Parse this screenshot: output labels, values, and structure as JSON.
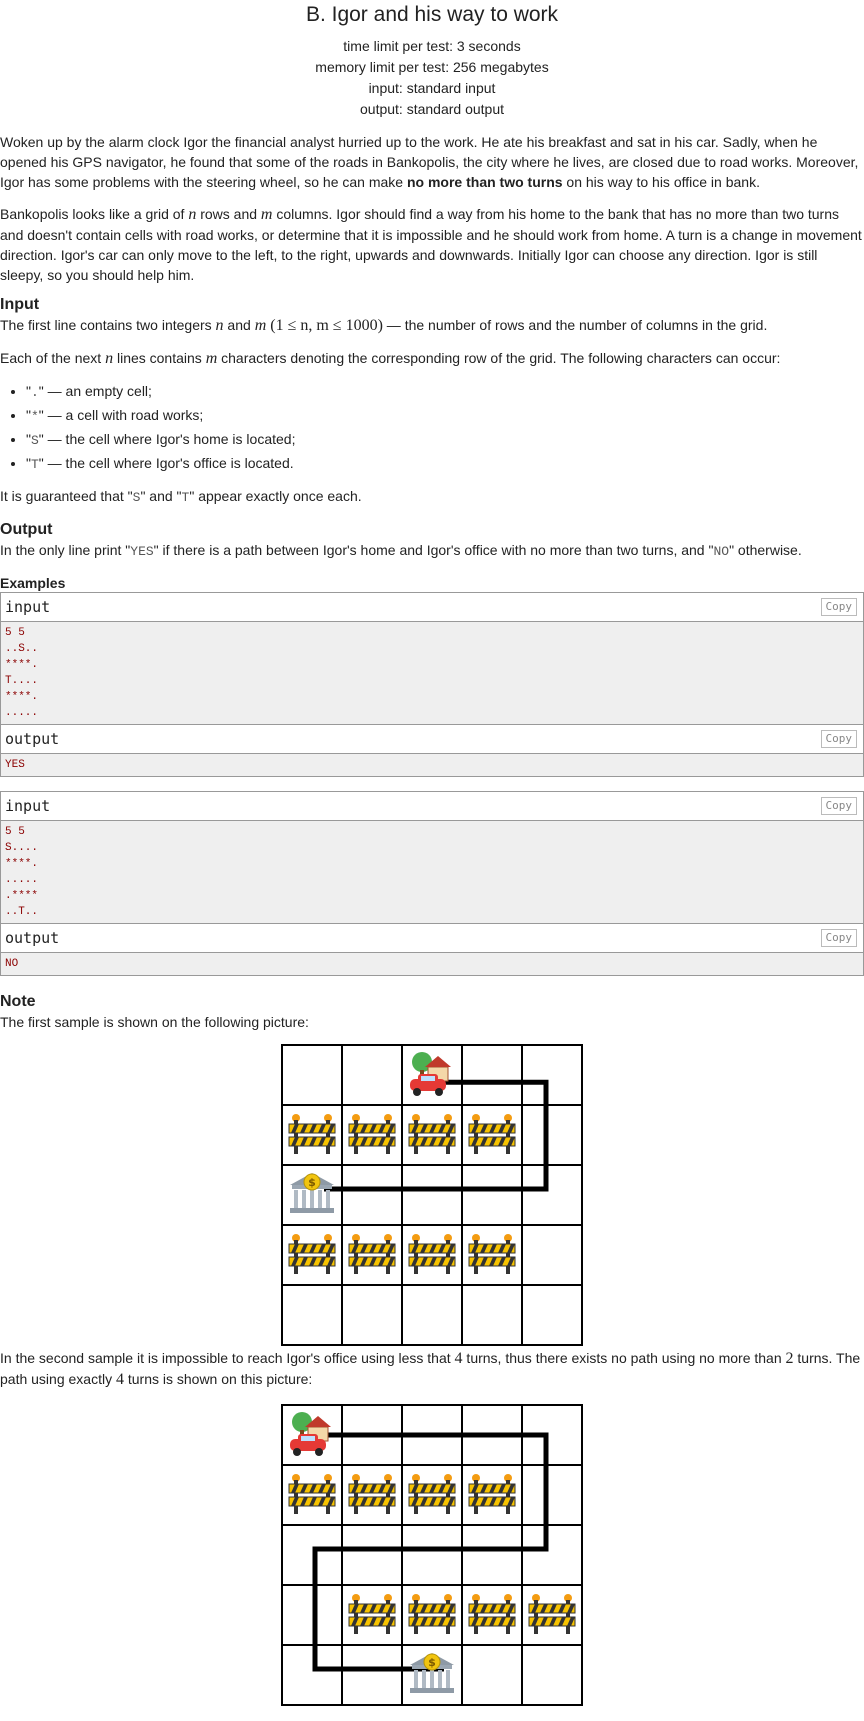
{
  "problem": {
    "title": "B. Igor and his way to work",
    "limits": [
      "time limit per test: 3 seconds",
      "memory limit per test: 256 megabytes",
      "input: standard input",
      "output: standard output"
    ]
  },
  "legend": {
    "p1_before": "Woken up by the alarm clock Igor the financial analyst hurried up to the work. He ate his breakfast and sat in his car. Sadly, when he opened his GPS navigator, he found that some of the roads in Bankopolis, the city where he lives, are closed due to road works. Moreover, Igor has some problems with the steering wheel, so he can make ",
    "p1_bold": "no more than two turns",
    "p1_after": " on his way to his office in bank.",
    "p2_a": "Bankopolis looks like a grid of ",
    "p2_n": "n",
    "p2_b": " rows and ",
    "p2_m": "m",
    "p2_c": " columns. Igor should find a way from his home to the bank that has no more than two turns and doesn't contain cells with road works, or determine that it is impossible and he should work from home. A turn is a change in movement direction. Igor's car can only move to the left, to the right, upwards and downwards. Initially Igor can choose any direction. Igor is still sleepy, so you should help him."
  },
  "input_spec": {
    "title": "Input",
    "l1_a": "The first line contains two integers ",
    "l1_n": "n",
    "l1_and": " and ",
    "l1_m": "m",
    "l1_constraint": " (1 ≤ n, m ≤ 1000)",
    "l1_b": " — the number of rows and the number of columns in the grid.",
    "l2_a": "Each of the next ",
    "l2_n": "n",
    "l2_b": " lines contains ",
    "l2_m": "m",
    "l2_c": " characters denoting the corresponding row of the grid. The following characters can occur:",
    "items": [
      {
        "q1": "\"",
        "code": ".",
        "q2": "\"",
        "desc": " — an empty cell;"
      },
      {
        "q1": "\"",
        "code": "*",
        "q2": "\"",
        "desc": " — a cell with road works;"
      },
      {
        "q1": "\"",
        "code": "S",
        "q2": "\"",
        "desc": " — the cell where Igor's home is located;"
      },
      {
        "q1": "\"",
        "code": "T",
        "q2": "\"",
        "desc": " — the cell where Igor's office is located."
      }
    ],
    "g_a": "It is guaranteed that \"",
    "g_s": "S",
    "g_b": "\" and \"",
    "g_t": "T",
    "g_c": "\" appear exactly once each."
  },
  "output_spec": {
    "title": "Output",
    "a": "In the only line print \"",
    "yes": "YES",
    "b": "\" if there is a path between Igor's home and Igor's office with no more than two turns, and \"",
    "no": "NO",
    "c": "\" otherwise."
  },
  "examples": {
    "title": "Examples",
    "input_label": "input",
    "output_label": "output",
    "copy_label": "Copy",
    "samples": [
      {
        "input": "5 5\n..S..\n****.\nT....\n****.\n.....",
        "output": "YES"
      },
      {
        "input": "5 5\nS....\n****.\n.....\n.****\n..T..",
        "output": "NO"
      }
    ]
  },
  "note": {
    "title": "Note",
    "p1": "The first sample is shown on the following picture:",
    "p2_a": "In the second sample it is impossible to reach Igor's office using less that ",
    "p2_4": "4",
    "p2_b": " turns, thus there exists no path using no more than ",
    "p2_2": "2",
    "p2_c": " turns. The path using exactly ",
    "p2_4b": "4",
    "p2_d": " turns is shown on this picture:"
  },
  "icons": {
    "home": "home-car-icon",
    "office": "bank-icon",
    "roadwork": "roadwork-barrier-icon"
  }
}
